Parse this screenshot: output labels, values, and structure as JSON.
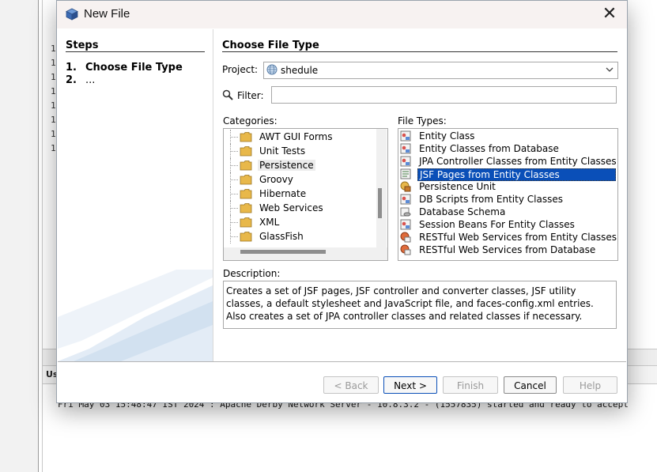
{
  "ide": {
    "line_numbers": [
      "1",
      "1",
      "1",
      "1",
      "1",
      "1",
      "1",
      "1"
    ],
    "output_tab_label": "Us",
    "output_line": "Fri May 03 15:48:47 IST 2024 : Apache Derby Network Server - 10.8.3.2 - (1557835) started and ready to accept"
  },
  "dialog": {
    "title": "New File",
    "close_glyph": "✕",
    "steps": {
      "heading": "Steps",
      "items": [
        {
          "num": "1.",
          "label": "Choose File Type"
        },
        {
          "num": "2.",
          "label": "..."
        }
      ]
    },
    "main": {
      "heading": "Choose File Type",
      "project_label": "Project:",
      "project_value": "shedule",
      "filter_label": "Filter:",
      "filter_value": "",
      "categories_label": "Categories:",
      "categories": [
        {
          "label": "AWT GUI Forms",
          "selected": false
        },
        {
          "label": "Unit Tests",
          "selected": false
        },
        {
          "label": "Persistence",
          "selected": true
        },
        {
          "label": "Groovy",
          "selected": false
        },
        {
          "label": "Hibernate",
          "selected": false
        },
        {
          "label": "Web Services",
          "selected": false
        },
        {
          "label": "XML",
          "selected": false
        },
        {
          "label": "GlassFish",
          "selected": false
        }
      ],
      "file_types_label": "File Types:",
      "file_types": [
        {
          "label": "Entity Class",
          "icon": "entity-class-icon",
          "selected": false
        },
        {
          "label": "Entity Classes from Database",
          "icon": "entity-db-icon",
          "selected": false
        },
        {
          "label": "JPA Controller Classes from Entity Classes",
          "icon": "jpa-controller-icon",
          "selected": false
        },
        {
          "label": "JSF Pages from Entity Classes",
          "icon": "jsf-pages-icon",
          "selected": true
        },
        {
          "label": "Persistence Unit",
          "icon": "persistence-unit-icon",
          "selected": false
        },
        {
          "label": "DB Scripts from Entity Classes",
          "icon": "db-scripts-icon",
          "selected": false
        },
        {
          "label": "Database Schema",
          "icon": "database-schema-icon",
          "selected": false
        },
        {
          "label": "Session Beans For Entity Classes",
          "icon": "session-beans-icon",
          "selected": false
        },
        {
          "label": "RESTful Web Services from Entity Classes",
          "icon": "restful-entity-icon",
          "selected": false
        },
        {
          "label": "RESTful Web Services from Database",
          "icon": "restful-db-icon",
          "selected": false
        }
      ],
      "description_label": "Description:",
      "description": "Creates a set of JSF pages, JSF controller and converter classes, JSF utility classes, a default stylesheet and JavaScript file, and faces-config.xml entries. Also creates a set of JPA controller classes and related classes if necessary."
    },
    "buttons": {
      "back": "< Back",
      "next": "Next >",
      "finish": "Finish",
      "cancel": "Cancel",
      "help": "Help"
    }
  },
  "colors": {
    "selection_blue": "#0a4fb8",
    "titlebar_bg": "#f7f2f1",
    "folder_yellow": "#e8b84a"
  }
}
